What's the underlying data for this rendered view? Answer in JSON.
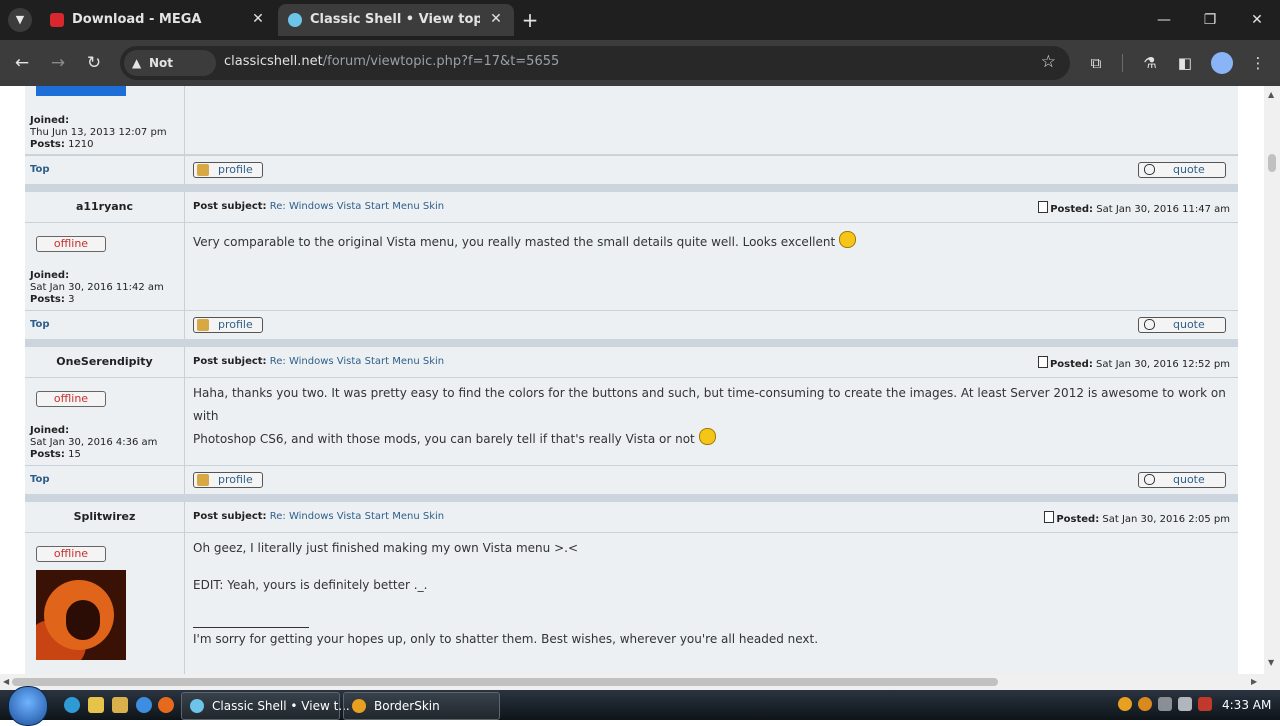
{
  "browser": {
    "tabs": [
      {
        "title": "Download - MEGA",
        "favicon": "mega-icon"
      },
      {
        "title": "Classic Shell • View topic - Win",
        "favicon": "classic-shell-icon"
      }
    ],
    "security_label": "Not secure",
    "url_host": "classicshell.net",
    "url_path": "/forum/viewtopic.php?f=17&t=5655"
  },
  "forum": {
    "top_label": "Top",
    "profile_label": "profile",
    "quote_label": "quote",
    "offline_label": "offline",
    "first_partial": {
      "joined_label": "Joined:",
      "joined_value": "Thu Jun 13, 2013 12:07 pm",
      "posts_label": "Posts:",
      "posts_value": "1210"
    },
    "posts": [
      {
        "author": "a11ryanc",
        "subject_label": "Post subject:",
        "subject": "Re: Windows Vista Start Menu Skin",
        "posted_label": "Posted:",
        "posted": "Sat Jan 30, 2016 11:47 am",
        "joined_label": "Joined:",
        "joined": "Sat Jan 30, 2016 11:42 am",
        "posts_label": "Posts:",
        "posts": "3",
        "body": "Very comparable to the original Vista menu, you really masted the small details quite well. Looks excellent"
      },
      {
        "author": "OneSerendipity",
        "subject_label": "Post subject:",
        "subject": "Re: Windows Vista Start Menu Skin",
        "posted_label": "Posted:",
        "posted": "Sat Jan 30, 2016 12:52 pm",
        "joined_label": "Joined:",
        "joined": "Sat Jan 30, 2016 4:36 am",
        "posts_label": "Posts:",
        "posts": "15",
        "body_line1": "Haha, thanks you two. It was pretty easy to find the colors for the buttons and such, but time-consuming to create the images. At least Server 2012 is awesome to work on with",
        "body_line2": "Photoshop CS6, and with those mods, you can barely tell if that's really Vista or not"
      },
      {
        "author": "Splitwirez",
        "subject_label": "Post subject:",
        "subject": "Re: Windows Vista Start Menu Skin",
        "posted_label": "Posted:",
        "posted": "Sat Jan 30, 2016 2:05 pm",
        "body_line1": "Oh geez, I literally just finished making my own Vista menu >.<",
        "body_line2": "EDIT: Yeah, yours is definitely better ._.",
        "signature": "I'm sorry for getting your hopes up, only to shatter them. Best wishes, wherever you're all headed next."
      }
    ]
  },
  "taskbar": {
    "tasks": [
      {
        "label": "Classic Shell • View t..."
      },
      {
        "label": "BorderSkin"
      }
    ],
    "clock": "4:33 AM"
  },
  "colors": {
    "link": "#2e5f8a",
    "offline": "#c8302b",
    "row_bg": "#ecf0f3",
    "separator": "#ccd5dd"
  }
}
